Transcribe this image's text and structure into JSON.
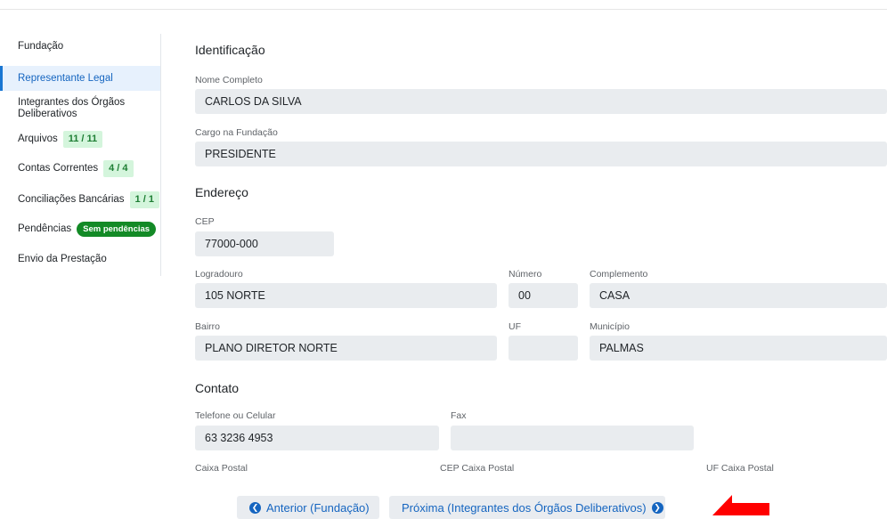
{
  "sidebar": {
    "items": [
      {
        "label": "Fundação"
      },
      {
        "label": "Representante Legal"
      },
      {
        "label": "Integrantes dos Órgãos Deliberativos"
      },
      {
        "label": "Arquivos",
        "badge": "11 / 11"
      },
      {
        "label": "Contas Correntes",
        "badge": "4 / 4"
      },
      {
        "label": "Conciliações Bancárias",
        "badge": "1 / 1"
      },
      {
        "label": "Pendências",
        "badge": "Sem pendências"
      },
      {
        "label": "Envio da Prestação"
      }
    ]
  },
  "identificacao": {
    "title": "Identificação",
    "nome_label": "Nome Completo",
    "nome_value": "CARLOS DA SILVA",
    "cargo_label": "Cargo na Fundação",
    "cargo_value": "PRESIDENTE"
  },
  "endereco": {
    "title": "Endereço",
    "cep_label": "CEP",
    "cep_value": "77000-000",
    "logradouro_label": "Logradouro",
    "logradouro_value": "105 NORTE",
    "numero_label": "Número",
    "numero_value": "00",
    "complemento_label": "Complemento",
    "complemento_value": "CASA",
    "bairro_label": "Bairro",
    "bairro_value": "PLANO DIRETOR NORTE",
    "uf_label": "UF",
    "uf_value": "",
    "municipio_label": "Município",
    "municipio_value": "PALMAS"
  },
  "contato": {
    "title": "Contato",
    "telefone_label": "Telefone ou Celular",
    "telefone_value": "63 3236 4953",
    "fax_label": "Fax",
    "fax_value": "",
    "caixa_postal_label": "Caixa Postal",
    "cep_caixa_postal_label": "CEP Caixa Postal",
    "uf_caixa_postal_label": "UF Caixa Postal"
  },
  "footer": {
    "prev_label": "Anterior (Fundação)",
    "next_label": "Próxima (Integrantes dos Órgãos Deliberativos)"
  },
  "icons": {
    "prev": "chevron-left-circle-icon",
    "next": "chevron-right-circle-icon",
    "annotation": "red-arrow-icon"
  },
  "colors": {
    "accent": "#1565c0",
    "active_bg": "#e7f1fd",
    "field_bg": "#e9ecef",
    "badge_green_bg": "#d4f5dc",
    "pill_green": "#138a26",
    "arrow_red": "#ff0000"
  }
}
